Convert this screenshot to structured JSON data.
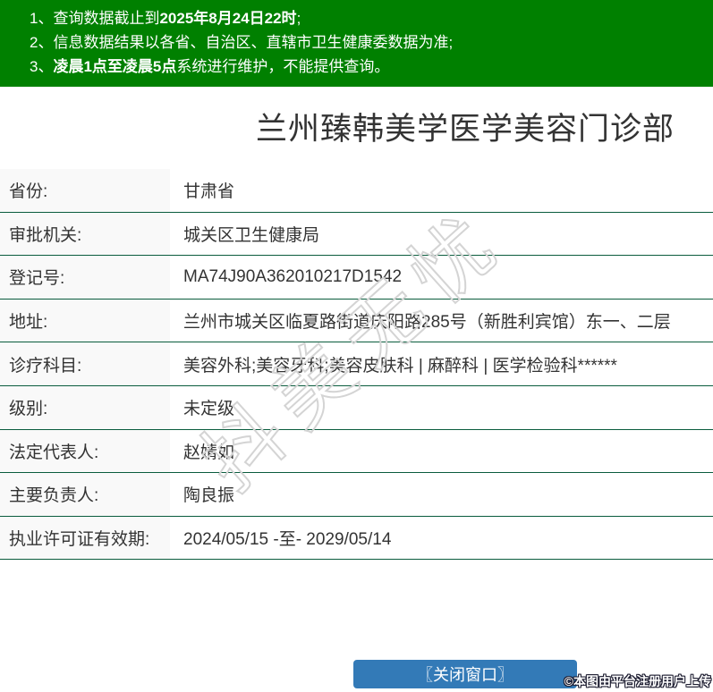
{
  "colors": {
    "banner_green": "#008000",
    "separator_green": "#0a5c3d",
    "button_blue": "#337ab7",
    "label_cell_bg": "#f9f9f9",
    "text_dark": "#333333",
    "watermark_gray": "#d4d4d4"
  },
  "banner": {
    "notices": [
      {
        "num": "1、",
        "pre": "查询数据截止到",
        "bold": "2025年8月24日22时",
        "post": ";"
      },
      {
        "num": "2、",
        "pre": "信息数据结果以各省、自治区、直辖市卫生健康委数据为准;",
        "bold": "",
        "post": ""
      },
      {
        "num": "3、",
        "pre": "",
        "bold": "凌晨1点至凌晨5点",
        "post": "系统进行维护，不能提供查询。"
      }
    ]
  },
  "page": {
    "title": "兰州臻韩美学医学美容门诊部"
  },
  "table": {
    "rows": [
      {
        "label": "省份:",
        "value": "甘肃省"
      },
      {
        "label": "审批机关:",
        "value": "城关区卫生健康局"
      },
      {
        "label": "登记号:",
        "value": "MA74J90A362010217D1542"
      },
      {
        "label": "地址:",
        "value": "兰州市城关区临夏路街道庆阳路285号（新胜利宾馆）东一、二层"
      },
      {
        "label": "诊疗科目:",
        "value": "美容外科;美容牙科;美容皮肤科 | 麻醉科 | 医学检验科******"
      },
      {
        "label": "级别:",
        "value": "未定级"
      },
      {
        "label": "法定代表人:",
        "value": "赵婧如"
      },
      {
        "label": "主要负责人:",
        "value": "陶良振"
      },
      {
        "label": "执业许可证有效期:",
        "value": "2024/05/15 -至- 2029/05/14"
      }
    ]
  },
  "watermark": {
    "text": "抖美无忧"
  },
  "footer": {
    "close_button": "〖关闭窗口〗",
    "stamp": "©本图由平台注册用户上传"
  }
}
